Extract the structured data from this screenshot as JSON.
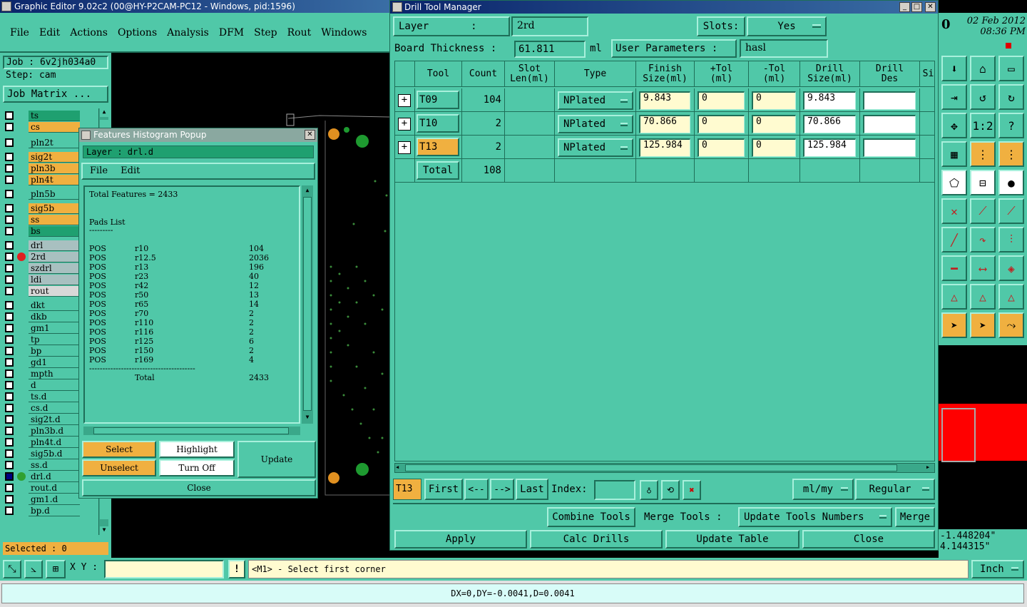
{
  "main_window": {
    "title": "Graphic Editor 9.02c2 (00@HY-P2CAM-PC12 - Windows, pid:1596)"
  },
  "menu": [
    "File",
    "Edit",
    "Actions",
    "Options",
    "Analysis",
    "DFM",
    "Step",
    "Rout",
    "Windows"
  ],
  "job": {
    "job_label": "Job : 6v2jh034a0",
    "step_label": "Step: cam",
    "matrix_button": "Job Matrix ..."
  },
  "layers": [
    {
      "name": "ts",
      "color": "#1fa070"
    },
    {
      "name": "cs",
      "color": "#f0b040"
    },
    {
      "name": "pln2t",
      "color": "#50c8a8"
    },
    {
      "name": "sig2t",
      "color": "#f0b040"
    },
    {
      "name": "pln3b",
      "color": "#f0b040"
    },
    {
      "name": "pln4t",
      "color": "#f0b040"
    },
    {
      "name": "pln5b",
      "color": "#50c8a8"
    },
    {
      "name": "sig5b",
      "color": "#f0b040"
    },
    {
      "name": "ss",
      "color": "#f0b040"
    },
    {
      "name": "bs",
      "color": "#1fa070"
    },
    {
      "name": "drl",
      "color": "#a8c0c0"
    },
    {
      "name": "2rd",
      "color": "#a8c0c0"
    },
    {
      "name": "szdrl",
      "color": "#a8c0c0"
    },
    {
      "name": "ldi",
      "color": "#a8c0c0"
    },
    {
      "name": "rout",
      "color": "#d8d8d8"
    },
    {
      "name": "dkt",
      "color": "#50c8a8"
    },
    {
      "name": "dkb",
      "color": "#50c8a8"
    },
    {
      "name": "gm1",
      "color": "#50c8a8"
    },
    {
      "name": "tp",
      "color": "#50c8a8"
    },
    {
      "name": "bp",
      "color": "#50c8a8"
    },
    {
      "name": "gd1",
      "color": "#50c8a8"
    },
    {
      "name": "mpth",
      "color": "#50c8a8"
    },
    {
      "name": "d",
      "color": "#50c8a8"
    },
    {
      "name": "ts.d",
      "color": "#50c8a8"
    },
    {
      "name": "cs.d",
      "color": "#50c8a8"
    },
    {
      "name": "sig2t.d",
      "color": "#50c8a8"
    },
    {
      "name": "pln3b.d",
      "color": "#50c8a8"
    },
    {
      "name": "pln4t.d",
      "color": "#50c8a8"
    },
    {
      "name": "sig5b.d",
      "color": "#50c8a8"
    },
    {
      "name": "ss.d",
      "color": "#50c8a8"
    },
    {
      "name": "drl.d",
      "color": "#50c8a8"
    },
    {
      "name": "rout.d",
      "color": "#50c8a8"
    },
    {
      "name": "gm1.d",
      "color": "#50c8a8"
    },
    {
      "name": "bp.d",
      "color": "#50c8a8"
    }
  ],
  "selected": "Selected : 0",
  "histogram": {
    "title": "Features Histogram Popup",
    "layer": "Layer :  drl.d",
    "menu": [
      "File",
      "Edit"
    ],
    "total": "Total Features = 2433",
    "pads_heading": "Pads List",
    "underline": "---------",
    "rows": [
      {
        "t": "POS",
        "s": "r10",
        "c": "104"
      },
      {
        "t": "POS",
        "s": "r12.5",
        "c": "2036"
      },
      {
        "t": "POS",
        "s": "r13",
        "c": "196"
      },
      {
        "t": "POS",
        "s": "r23",
        "c": "40"
      },
      {
        "t": "POS",
        "s": "r42",
        "c": "12"
      },
      {
        "t": "POS",
        "s": "r50",
        "c": "13"
      },
      {
        "t": "POS",
        "s": "r65",
        "c": "14"
      },
      {
        "t": "POS",
        "s": "r70",
        "c": "2"
      },
      {
        "t": "POS",
        "s": "r110",
        "c": "2"
      },
      {
        "t": "POS",
        "s": "r116",
        "c": "2"
      },
      {
        "t": "POS",
        "s": "r125",
        "c": "6"
      },
      {
        "t": "POS",
        "s": "r150",
        "c": "2"
      },
      {
        "t": "POS",
        "s": "r169",
        "c": "4"
      }
    ],
    "separator": "----------------------------------------",
    "total_label": "Total",
    "total_value": "2433",
    "buttons": {
      "select": "Select",
      "highlight": "Highlight",
      "update": "Update",
      "unselect": "Unselect",
      "turn_off": "Turn Off",
      "close": "Close"
    }
  },
  "drill": {
    "title": "Drill Tool Manager",
    "layer_label": "Layer       :",
    "layer_value": "2rd",
    "slots_label": "Slots:",
    "slots_value": "Yes",
    "board_label": "Board Thickness :",
    "board_value": "61.811",
    "board_unit": "ml",
    "user_params_label": "User Parameters :",
    "user_params_value": "hasl",
    "headers": [
      "Tool",
      "Count",
      "Slot\nLen(ml)",
      "Type",
      "Finish\nSize(ml)",
      "+Tol\n(ml)",
      "-Tol\n(ml)",
      "Drill\nSize(ml)",
      "Drill\nDes",
      "Si"
    ],
    "rows": [
      {
        "tool": "T09",
        "count": "104",
        "type": "NPlated",
        "finish": "9.843",
        "ptol": "0",
        "mtol": "0",
        "drill": "9.843",
        "des": ""
      },
      {
        "tool": "T10",
        "count": "2",
        "type": "NPlated",
        "finish": "70.866",
        "ptol": "0",
        "mtol": "0",
        "drill": "70.866",
        "des": ""
      },
      {
        "tool": "T13",
        "count": "2",
        "type": "NPlated",
        "finish": "125.984",
        "ptol": "0",
        "mtol": "0",
        "drill": "125.984",
        "des": ""
      }
    ],
    "total_label": "Total",
    "total_count": "108",
    "current_tool": "T13",
    "nav": {
      "first": "First",
      "prev": "<--",
      "next": "-->",
      "last": "Last",
      "index_label": "Index:",
      "index_value": ""
    },
    "units": "ml/my",
    "mode": "Regular",
    "combine": "Combine Tools",
    "merge_label": "Merge Tools :",
    "update_numbers": "Update Tools Numbers",
    "merge": "Merge",
    "apply": "Apply",
    "calc": "Calc Drills",
    "update_table": "Update Table",
    "close": "Close"
  },
  "clock": {
    "date": "02 Feb 2012",
    "time": "08:36 PM"
  },
  "coords": {
    "x": "-1.448204\"",
    "y": "4.144315\""
  },
  "bottom": {
    "xy_label": "X Y :",
    "xy_value": "",
    "prompt": "<M1> - Select first corner",
    "units": "Inch",
    "status": "DX=0,DY=-0.0041,D=0.0041"
  }
}
